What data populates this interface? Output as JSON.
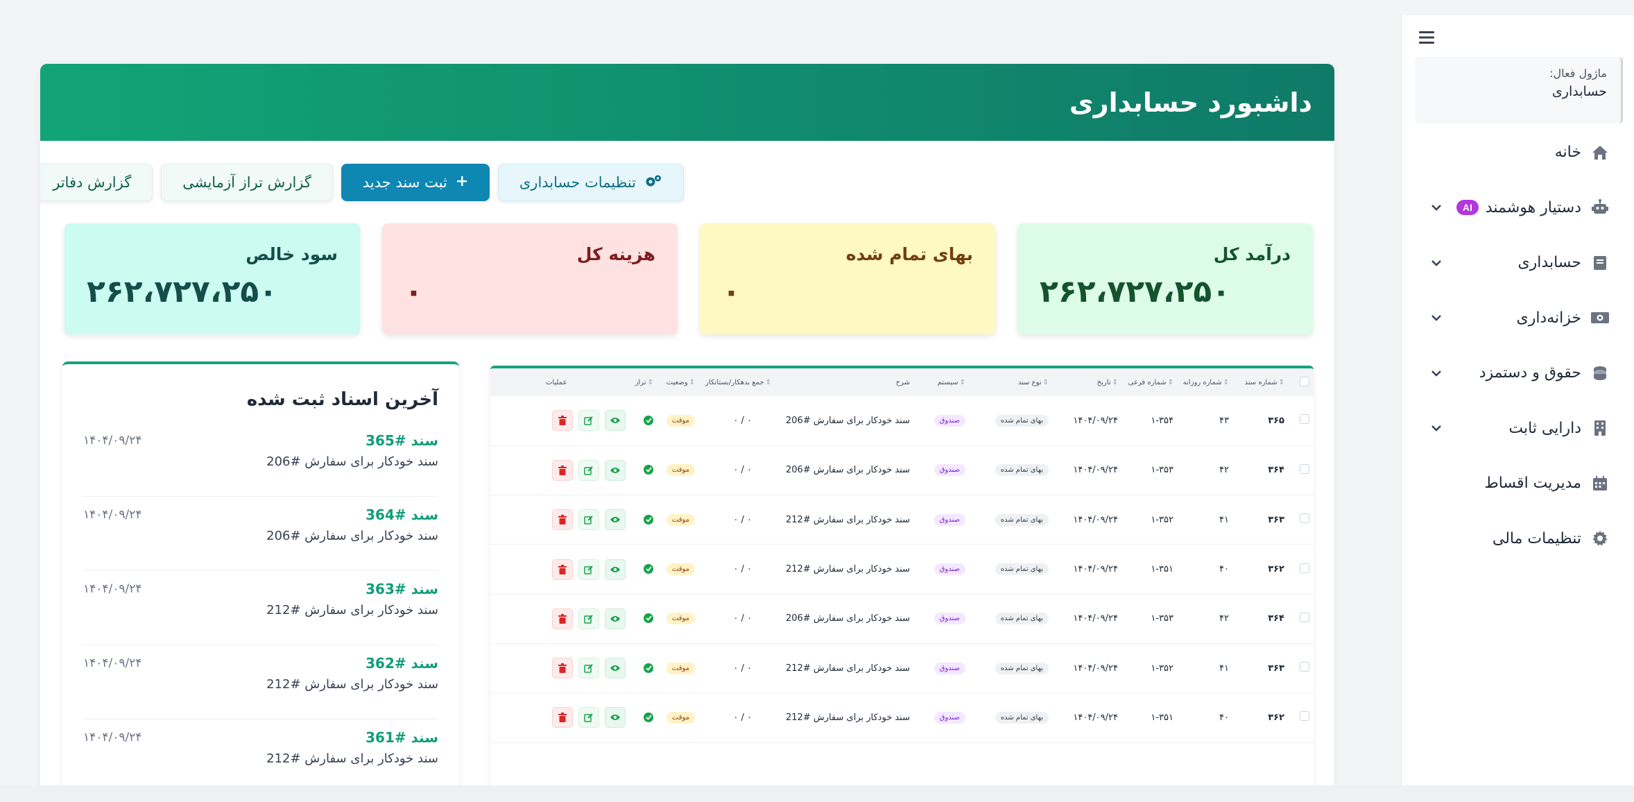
{
  "sidebar": {
    "module_label": "ماژول فعال:",
    "module_value": "حسابداری",
    "items": [
      {
        "label": "خانه",
        "icon": "home-icon",
        "has_chevron": false
      },
      {
        "label": "دستیار هوشمند",
        "icon": "robot-icon",
        "has_chevron": true,
        "badge": "AI"
      },
      {
        "label": "حسابداری",
        "icon": "book-icon",
        "has_chevron": true
      },
      {
        "label": "خزانه‌داری",
        "icon": "cash-icon",
        "has_chevron": true
      },
      {
        "label": "حقوق و دستمزد",
        "icon": "coins-icon",
        "has_chevron": true
      },
      {
        "label": "دارایی ثابت",
        "icon": "building-icon",
        "has_chevron": true
      },
      {
        "label": "مدیریت اقساط",
        "icon": "calendar-icon",
        "has_chevron": false
      },
      {
        "label": "تنظیمات مالی",
        "icon": "gear-icon",
        "has_chevron": false
      }
    ]
  },
  "header": {
    "title": "داشبورد حسابداری"
  },
  "toolbar": {
    "settings_label": "تنظیمات حسابداری",
    "new_doc_label": "ثبت سند جدید",
    "trial_balance_label": "گزارش تراز آزمایشی",
    "ledger_label": "گزارش دفاتر"
  },
  "stats": [
    {
      "title": "درآمد کل",
      "value": "۲۶۲،۷۲۷،۲۵۰",
      "color": "#dcfce7"
    },
    {
      "title": "بهای تمام شده",
      "value": "۰",
      "color": "#fef9c3"
    },
    {
      "title": "هزینه کل",
      "value": "۰",
      "color": "#fee2e2"
    },
    {
      "title": "سود خالص",
      "value": "۲۶۲،۷۲۷،۲۵۰",
      "color": "#ccfbf1"
    }
  ],
  "table": {
    "headers": [
      "شماره سند",
      "شماره روزانه",
      "شماره فرعی",
      "تاریخ",
      "نوع سند",
      "سیستم",
      "شرح",
      "جمع بدهکار/بستانکار",
      "وضعیت",
      "تراز",
      "عملیات"
    ],
    "rows": [
      [
        "۳۶۵",
        "۴۳",
        "۱-۳۵۴",
        "۱۴۰۴/۰۹/۲۴",
        "بهای تمام شده",
        "صندوق",
        "سند خودکار برای سفارش #206",
        "۰ / ۰",
        "موقت"
      ],
      [
        "۳۶۴",
        "۴۲",
        "۱-۳۵۳",
        "۱۴۰۴/۰۹/۲۴",
        "بهای تمام شده",
        "صندوق",
        "سند خودکار برای سفارش #206",
        "۰ / ۰",
        "موقت"
      ],
      [
        "۳۶۳",
        "۴۱",
        "۱-۳۵۲",
        "۱۴۰۴/۰۹/۲۴",
        "بهای تمام شده",
        "صندوق",
        "سند خودکار برای سفارش #212",
        "۰ / ۰",
        "موقت"
      ],
      [
        "۳۶۲",
        "۴۰",
        "۱-۳۵۱",
        "۱۴۰۴/۰۹/۲۴",
        "بهای تمام شده",
        "صندوق",
        "سند خودکار برای سفارش #212",
        "۰ / ۰",
        "موقت"
      ],
      [
        "۳۶۴",
        "۴۲",
        "۱-۳۵۳",
        "۱۴۰۴/۰۹/۲۴",
        "بهای تمام شده",
        "صندوق",
        "سند خودکار برای سفارش #206",
        "۰ / ۰",
        "موقت"
      ],
      [
        "۳۶۳",
        "۴۱",
        "۱-۳۵۲",
        "۱۴۰۴/۰۹/۲۴",
        "بهای تمام شده",
        "صندوق",
        "سند خودکار برای سفارش #212",
        "۰ / ۰",
        "موقت"
      ],
      [
        "۳۶۲",
        "۴۰",
        "۱-۳۵۱",
        "۱۴۰۴/۰۹/۲۴",
        "بهای تمام شده",
        "صندوق",
        "سند خودکار برای سفارش #212",
        "۰ / ۰",
        "موقت"
      ]
    ]
  },
  "recent": {
    "title": "آخرین اسناد ثبت شده",
    "items": [
      {
        "no": "سند #365",
        "desc": "سند خودکار برای سفارش #206",
        "date": "۱۴۰۴/۰۹/۲۴"
      },
      {
        "no": "سند #364",
        "desc": "سند خودکار برای سفارش #206",
        "date": "۱۴۰۴/۰۹/۲۴"
      },
      {
        "no": "سند #363",
        "desc": "سند خودکار برای سفارش #212",
        "date": "۱۴۰۴/۰۹/۲۴"
      },
      {
        "no": "سند #362",
        "desc": "سند خودکار برای سفارش #212",
        "date": "۱۴۰۴/۰۹/۲۴"
      },
      {
        "no": "سند #361",
        "desc": "سند خودکار برای سفارش #212",
        "date": "۱۴۰۴/۰۹/۲۴"
      }
    ]
  }
}
